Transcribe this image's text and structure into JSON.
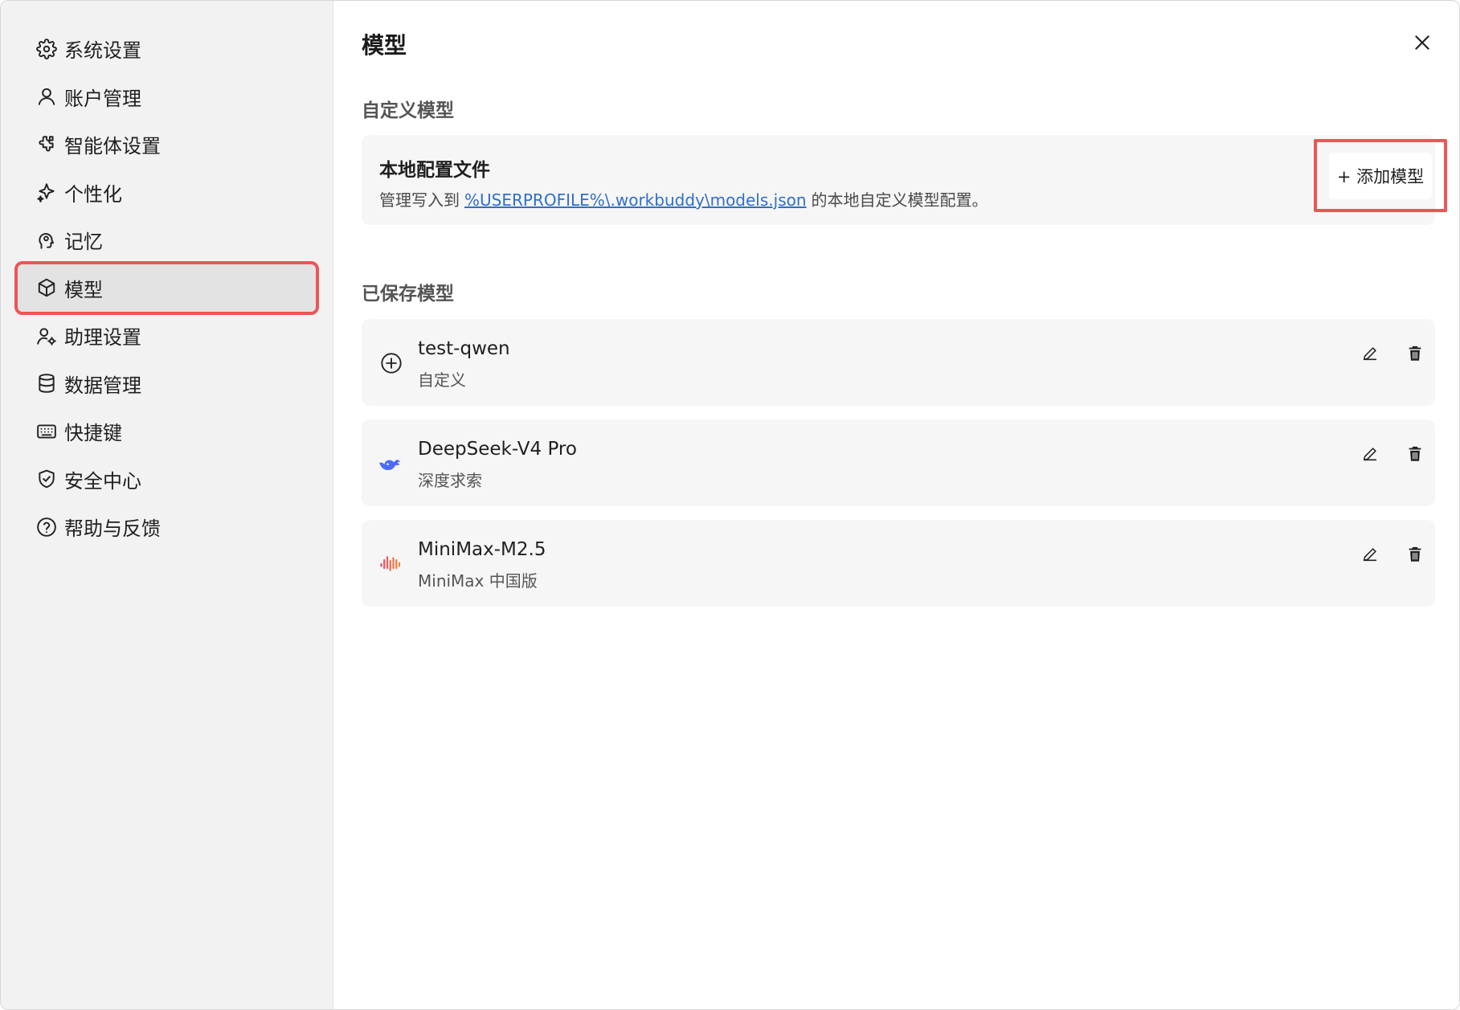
{
  "sidebar": {
    "items": [
      {
        "label": "系统设置",
        "icon": "gear-icon"
      },
      {
        "label": "账户管理",
        "icon": "user-icon"
      },
      {
        "label": "智能体设置",
        "icon": "puzzle-icon"
      },
      {
        "label": "个性化",
        "icon": "sparkle-icon"
      },
      {
        "label": "记忆",
        "icon": "brain-head-icon"
      },
      {
        "label": "模型",
        "icon": "cube-icon",
        "active": true
      },
      {
        "label": "助理设置",
        "icon": "user-gear-icon"
      },
      {
        "label": "数据管理",
        "icon": "database-icon"
      },
      {
        "label": "快捷键",
        "icon": "keyboard-icon"
      },
      {
        "label": "安全中心",
        "icon": "shield-check-icon"
      },
      {
        "label": "帮助与反馈",
        "icon": "help-circle-icon"
      }
    ]
  },
  "main": {
    "title": "模型",
    "custom_section": {
      "heading": "自定义模型",
      "card_title": "本地配置文件",
      "desc_prefix": "管理写入到",
      "desc_link": "%USERPROFILE%\\.workbuddy\\models.json",
      "desc_suffix": "的本地自定义模型配置。",
      "add_button": "+ 添加模型"
    },
    "saved_section": {
      "heading": "已保存模型",
      "models": [
        {
          "name": "test-qwen",
          "provider": "自定义",
          "icon": "plus-circle-icon"
        },
        {
          "name": "DeepSeek-V4 Pro",
          "provider": "深度求索",
          "icon": "deepseek-whale-icon"
        },
        {
          "name": "MiniMax-M2.5",
          "provider": "MiniMax 中国版",
          "icon": "minimax-wave-icon"
        }
      ]
    }
  },
  "colors": {
    "highlight": "#ee5555",
    "link": "#2f6fc9",
    "deepseek": "#4d6bfe",
    "minimax_start": "#e84a6a",
    "minimax_end": "#f08a3a"
  }
}
